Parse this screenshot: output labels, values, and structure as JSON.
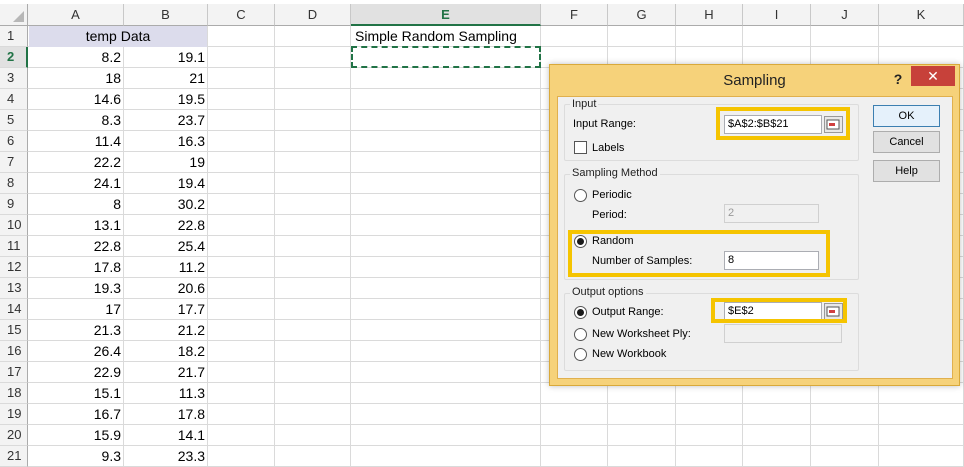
{
  "sheet": {
    "columns": [
      "A",
      "B",
      "C",
      "D",
      "E",
      "F",
      "G",
      "H",
      "I",
      "J",
      "K"
    ],
    "rows": [
      "1",
      "2",
      "3",
      "4",
      "5",
      "6",
      "7",
      "8",
      "9",
      "10",
      "11",
      "12",
      "13",
      "14",
      "15",
      "16",
      "17",
      "18",
      "19",
      "20",
      "21"
    ],
    "header_label": "temp Data",
    "e1_text": "Simple Random Sampling",
    "data": [
      [
        "8.2",
        "19.1"
      ],
      [
        "18",
        "21"
      ],
      [
        "14.6",
        "19.5"
      ],
      [
        "8.3",
        "23.7"
      ],
      [
        "11.4",
        "16.3"
      ],
      [
        "22.2",
        "19"
      ],
      [
        "24.1",
        "19.4"
      ],
      [
        "8",
        "30.2"
      ],
      [
        "13.1",
        "22.8"
      ],
      [
        "22.8",
        "25.4"
      ],
      [
        "17.8",
        "11.2"
      ],
      [
        "19.3",
        "20.6"
      ],
      [
        "17",
        "17.7"
      ],
      [
        "21.3",
        "21.2"
      ],
      [
        "26.4",
        "18.2"
      ],
      [
        "22.9",
        "21.7"
      ],
      [
        "15.1",
        "11.3"
      ],
      [
        "16.7",
        "17.8"
      ],
      [
        "15.9",
        "14.1"
      ],
      [
        "9.3",
        "23.3"
      ]
    ]
  },
  "dialog": {
    "title": "Sampling",
    "help_glyph": "?",
    "close_glyph": "✕",
    "input_group": "Input",
    "input_range_label": "Input Range:",
    "input_range_value": "$A$2:$B$21",
    "labels_label": "Labels",
    "method_group": "Sampling Method",
    "periodic_label": "Periodic",
    "period_label": "Period:",
    "period_value": "2",
    "random_label": "Random",
    "num_samples_label": "Number of Samples:",
    "num_samples_value": "8",
    "output_group": "Output options",
    "output_range_label": "Output Range:",
    "output_range_value": "$E$2",
    "new_ply_label": "New Worksheet Ply:",
    "new_workbook_label": "New Workbook",
    "ok_label": "OK",
    "cancel_label": "Cancel",
    "help_label": "Help"
  },
  "colors": {
    "accent": "#217346",
    "highlight": "#f5c400",
    "dialog_frame": "#f6d27a",
    "close": "#c7413a"
  }
}
